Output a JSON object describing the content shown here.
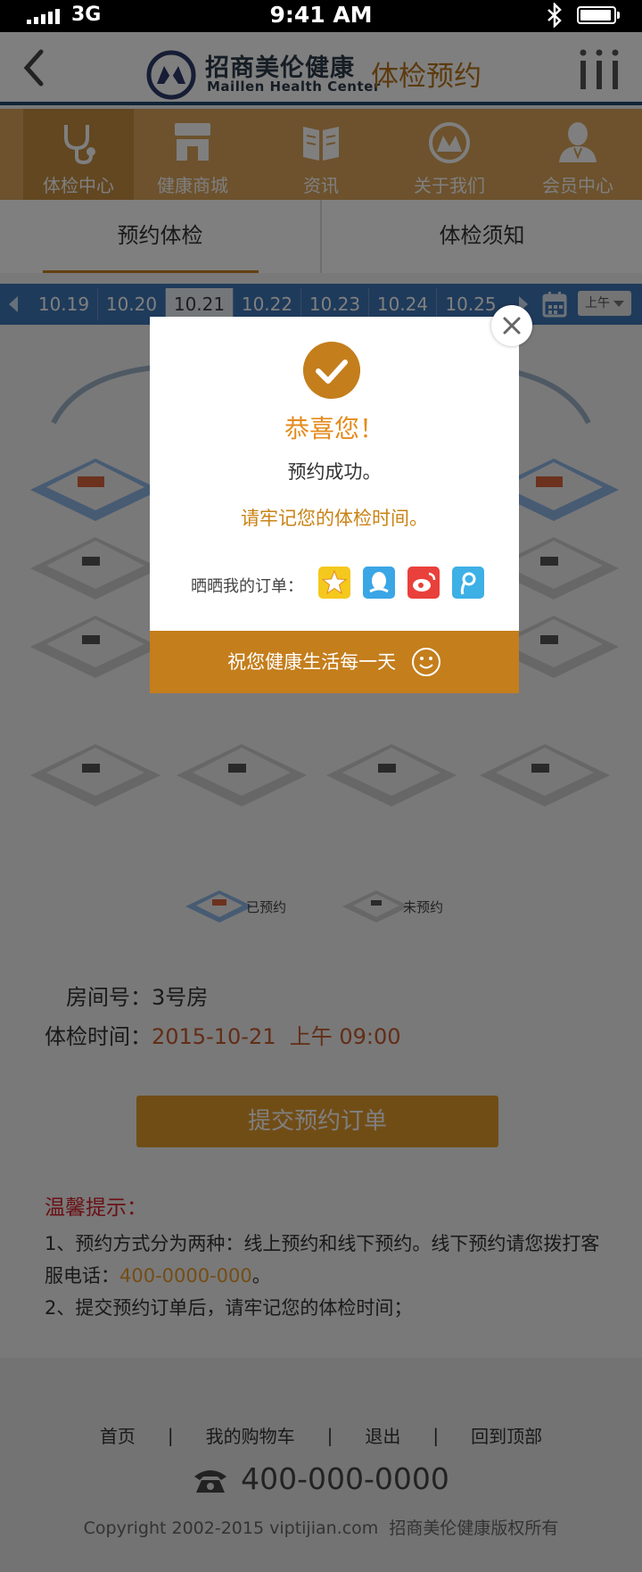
{
  "status_bar": {
    "network": "3G",
    "time": "9:41 AM"
  },
  "header": {
    "brand_cn": "招商美伦健康",
    "brand_en": "Maillen Health Center",
    "page_title": "体检预约"
  },
  "nav": {
    "items": [
      {
        "label": "体检中心",
        "icon": "stethoscope-icon"
      },
      {
        "label": "健康商城",
        "icon": "store-icon"
      },
      {
        "label": "资讯",
        "icon": "book-icon"
      },
      {
        "label": "关于我们",
        "icon": "logo-icon"
      },
      {
        "label": "会员中心",
        "icon": "user-icon"
      }
    ]
  },
  "tabs": [
    "预约体检",
    "体检须知"
  ],
  "dates": {
    "items": [
      "10.19",
      "10.20",
      "10.21",
      "10.22",
      "10.23",
      "10.24",
      "10.25"
    ],
    "selected": "10.21",
    "period": "上午"
  },
  "legend": {
    "booked": "已预约",
    "available": "未预约"
  },
  "info": {
    "room_label": "房间号：",
    "room_value": "3号房",
    "time_label": "体检时间：",
    "time_value": "2015-10-21  上午 09:00"
  },
  "submit_label": "提交预约订单",
  "tips": {
    "title": "温馨提示：",
    "line1_a": "1、预约方式分为两种：线上预约和线下预约。线下预约请您拨打客服电话：",
    "phone": "400-0000-000",
    "line1_b": "。",
    "line2": "2、提交预约订单后，请牢记您的体检时间；"
  },
  "footer": {
    "links": [
      "首页",
      "我的购物车",
      "退出",
      "回到顶部"
    ],
    "hotline": "400-000-0000",
    "copyright": "Copyright 2002-2015 viptijian.com  招商美伦健康版权所有"
  },
  "modal": {
    "congrats": "恭喜您！",
    "success": "预约成功。",
    "remember": "请牢记您的体检时间。",
    "share_label": "晒晒我的订单：",
    "share_icons": [
      "star-icon",
      "qq-icon",
      "weibo-icon",
      "tencent-weibo-icon"
    ],
    "bottom_text": "祝您健康生活每一天"
  },
  "colors": {
    "accent": "#c47e1c",
    "nav": "#dba55a",
    "date_strip": "#3f76b6",
    "header_border": "#204a70"
  }
}
